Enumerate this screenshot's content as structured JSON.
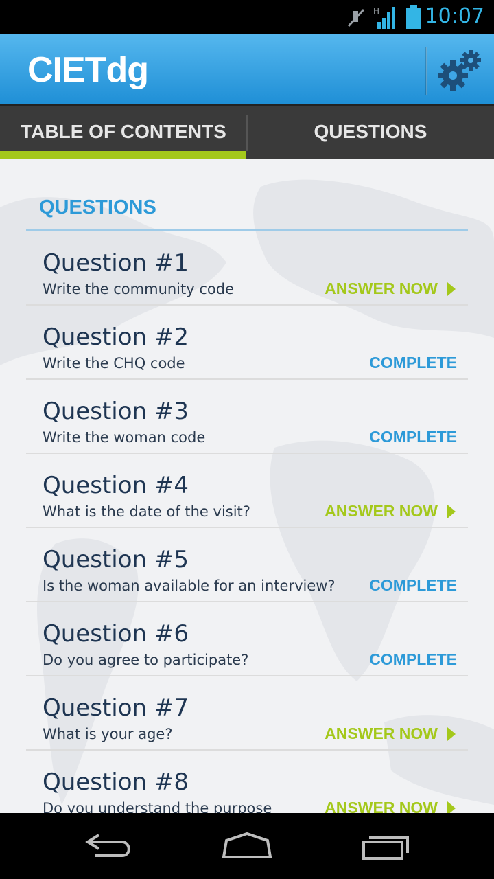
{
  "status_bar": {
    "time": "10:07",
    "network_type": "H"
  },
  "app": {
    "title": "CIETdg"
  },
  "tabs": [
    {
      "label": "TABLE OF CONTENTS",
      "selected": true
    },
    {
      "label": "QUESTIONS",
      "selected": false
    }
  ],
  "section": {
    "header": "QUESTIONS"
  },
  "questions": [
    {
      "title": "Question #1",
      "description": "Write the community code",
      "status": "ANSWER NOW"
    },
    {
      "title": "Question #2",
      "description": "Write the CHQ code",
      "status": "COMPLETE"
    },
    {
      "title": "Question #3",
      "description": "Write the woman code",
      "status": "COMPLETE"
    },
    {
      "title": "Question #4",
      "description": "What is the date of the visit?",
      "status": "ANSWER NOW"
    },
    {
      "title": "Question #5",
      "description": "Is the woman available for an interview?",
      "status": "COMPLETE"
    },
    {
      "title": "Question #6",
      "description": "Do you agree to participate?",
      "status": "COMPLETE"
    },
    {
      "title": "Question #7",
      "description": "What is your age?",
      "status": "ANSWER NOW"
    },
    {
      "title": "Question #8",
      "description": "Do you understand the purpose",
      "status": "ANSWER NOW"
    }
  ],
  "colors": {
    "action_bar": "#2f9fe0",
    "accent_green": "#a4c81b",
    "accent_blue": "#2d9ad8",
    "tab_bar": "#3a3a3a"
  },
  "icons": {
    "settings": "gear-icon",
    "back": "back-icon",
    "home": "home-icon",
    "recent": "recent-apps-icon"
  }
}
